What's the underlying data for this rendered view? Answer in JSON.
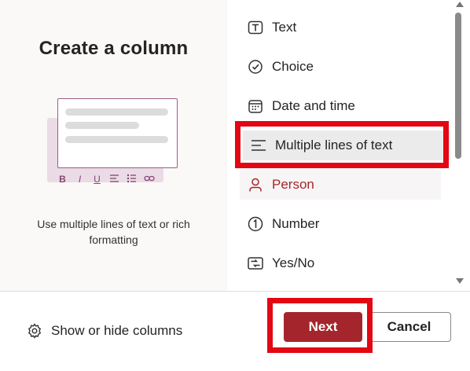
{
  "left_panel": {
    "title": "Create a column",
    "description": "Use multiple lines of text or rich formatting",
    "illustration_toolbar": {
      "bold": "B",
      "italic": "I",
      "underline": "U"
    }
  },
  "column_types": [
    {
      "label": "Text",
      "icon": "text-box-icon",
      "state": "normal"
    },
    {
      "label": "Choice",
      "icon": "choice-check-icon",
      "state": "normal"
    },
    {
      "label": "Date and time",
      "icon": "calendar-icon",
      "state": "normal"
    },
    {
      "label": "Multiple lines of text",
      "icon": "multiline-text-icon",
      "state": "selected"
    },
    {
      "label": "Person",
      "icon": "person-icon",
      "state": "hovered"
    },
    {
      "label": "Number",
      "icon": "number-icon",
      "state": "normal"
    },
    {
      "label": "Yes/No",
      "icon": "yes-no-toggle-icon",
      "state": "normal"
    }
  ],
  "footer": {
    "show_hide_label": "Show or hide columns",
    "next_label": "Next",
    "cancel_label": "Cancel"
  },
  "colors": {
    "accent": "#a4262c",
    "highlight_box": "#e30613",
    "illustration_border": "#9d5b8e",
    "illustration_back": "#eadbe6"
  }
}
